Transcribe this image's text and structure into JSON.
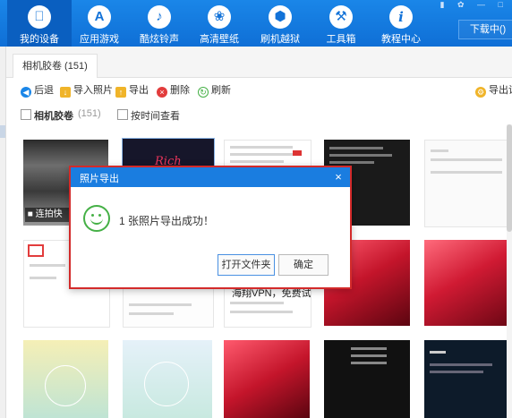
{
  "nav": {
    "items": [
      {
        "label": "我的设备",
        "icon": "apple-icon",
        "glyph": ""
      },
      {
        "label": "应用游戏",
        "icon": "appstore-icon",
        "glyph": "A"
      },
      {
        "label": "酷炫铃声",
        "icon": "bell-icon",
        "glyph": "♪"
      },
      {
        "label": "高清壁纸",
        "icon": "flower-icon",
        "glyph": "❀"
      },
      {
        "label": "刷机越狱",
        "icon": "dropbox-icon",
        "glyph": "⬢"
      },
      {
        "label": "工具箱",
        "icon": "tools-icon",
        "glyph": "⚒"
      },
      {
        "label": "教程中心",
        "icon": "info-icon",
        "glyph": "i"
      }
    ],
    "download_label": "下载中()"
  },
  "tab": {
    "label": "相机胶卷 (151)"
  },
  "toolbar": {
    "back": "后退",
    "import": "导入照片",
    "export": "导出",
    "delete": "删除",
    "refresh": "刷新",
    "export_settings": "导出设"
  },
  "filter": {
    "album_label": "相机胶卷",
    "album_count": "(151)",
    "by_time": "按时间查看"
  },
  "grid": {
    "caption_live": "连拍快",
    "promo_text": "海翔VPN，免费试用"
  },
  "dialog": {
    "title": "照片导出",
    "close_glyph": "×",
    "message": "1 张照片导出成功！",
    "open_folder": "打开文件夹",
    "ok": "确定"
  },
  "colors": {
    "accent": "#1a7de0",
    "success": "#45b046",
    "highlight_border": "#d32a2a"
  }
}
